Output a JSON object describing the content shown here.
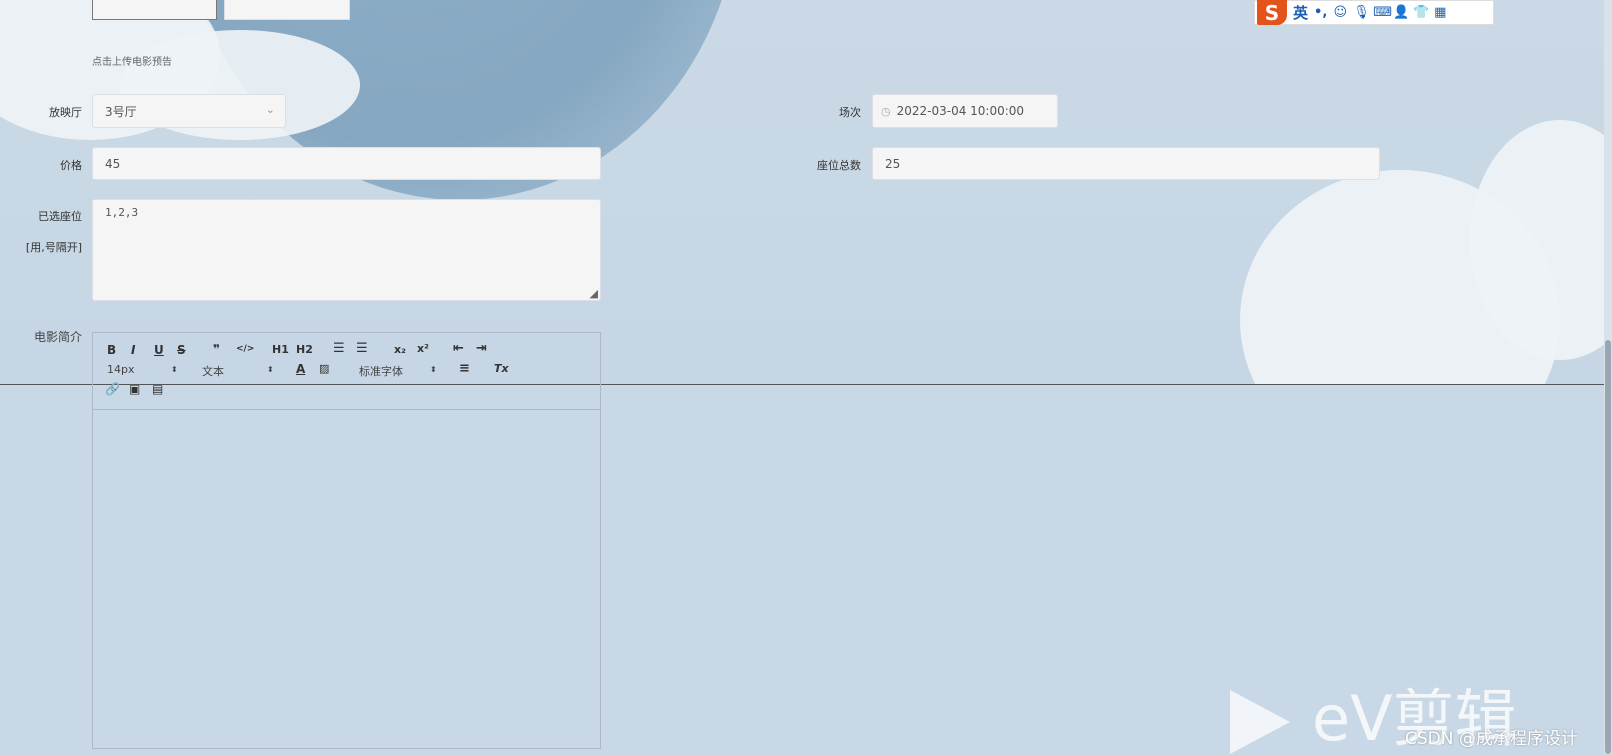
{
  "ime": {
    "logo": "S",
    "lang": "英",
    "punct": "•,",
    "icons": [
      "emoji-icon",
      "mic-icon",
      "keyboard-icon",
      "user-icon",
      "skin-icon",
      "apps-icon"
    ]
  },
  "form": {
    "upload_hint": "点击上传电影预告",
    "hall": {
      "label": "放映厅",
      "value": "3号厅"
    },
    "session": {
      "label": "场次",
      "value": "2022-03-04 10:00:00"
    },
    "price": {
      "label": "价格",
      "value": "45"
    },
    "seats_total": {
      "label": "座位总数",
      "value": "25"
    },
    "selected_seats": {
      "label": "已选座位",
      "sublabel": "[用,号隔开]",
      "value": "1,2,3"
    },
    "intro": {
      "label": "电影简介"
    }
  },
  "editor": {
    "font_size": "14px",
    "header_select": "文本",
    "font_family": "标准字体",
    "buttons": {
      "bold": "B",
      "italic": "I",
      "underline": "U",
      "strike": "S",
      "quote": "❞",
      "code": "</>",
      "h1": "H1",
      "h2": "H2",
      "sub": "x₂",
      "sup": "x²",
      "clean": "Tx"
    }
  },
  "watermark": {
    "brand": "eV剪辑",
    "csdn": "CSDN @成承程序设计"
  }
}
